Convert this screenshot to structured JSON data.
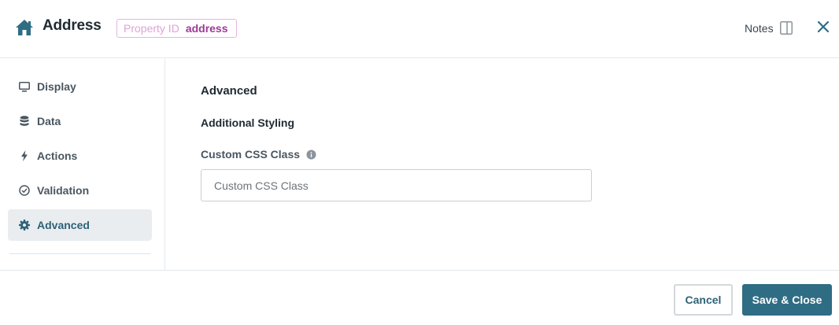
{
  "header": {
    "title": "Address",
    "property_id_label": "Property ID",
    "property_id_value": "address",
    "notes_label": "Notes"
  },
  "sidebar": {
    "items": [
      {
        "label": "Display",
        "icon": "monitor-icon",
        "active": false
      },
      {
        "label": "Data",
        "icon": "database-icon",
        "active": false
      },
      {
        "label": "Actions",
        "icon": "lightning-icon",
        "active": false
      },
      {
        "label": "Validation",
        "icon": "check-circle-icon",
        "active": false
      },
      {
        "label": "Advanced",
        "icon": "gear-icon",
        "active": true
      }
    ]
  },
  "main": {
    "section_title": "Advanced",
    "subsection_title": "Additional Styling",
    "custom_css": {
      "label": "Custom CSS Class",
      "placeholder": "Custom CSS Class",
      "value": ""
    }
  },
  "footer": {
    "cancel_label": "Cancel",
    "save_label": "Save & Close"
  },
  "colors": {
    "accent": "#2f6d84",
    "active_nav_bg": "#e9edf0",
    "badge_border": "#e7b3e2",
    "badge_value": "#9c3a96"
  }
}
